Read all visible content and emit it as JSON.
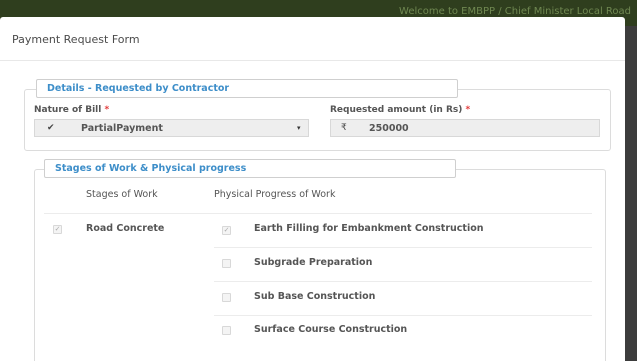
{
  "background_bar": {
    "text": "Welcome to EMBPP / Chief Minister Local Road"
  },
  "modal": {
    "title": "Payment Request Form"
  },
  "details_section": {
    "legend": "Details - Requested by Contractor",
    "nature_of_bill": {
      "label": "Nature of Bill",
      "required_mark": "*",
      "icon": "check-icon",
      "value": "PartialPayment",
      "caret": "▾"
    },
    "requested_amount": {
      "label": "Requested amount (in Rs)",
      "required_mark": "*",
      "currency_symbol": "₹",
      "value": "250000"
    }
  },
  "stages_section": {
    "legend": "Stages of Work & Physical progress",
    "col_stage": "Stages of Work",
    "col_progress": "Physical Progress of Work",
    "stage": {
      "name": "Road Concrete",
      "checked": true
    },
    "progress_items": [
      {
        "label": "Earth Filling for Embankment Construction",
        "checked": true
      },
      {
        "label": "Subgrade Preparation",
        "checked": false
      },
      {
        "label": "Sub Base Construction",
        "checked": false
      },
      {
        "label": "Surface Course Construction",
        "checked": false
      }
    ]
  },
  "colors": {
    "accent": "#3d8ec9",
    "required": "#e23b3b",
    "backdrop": "#454545"
  }
}
